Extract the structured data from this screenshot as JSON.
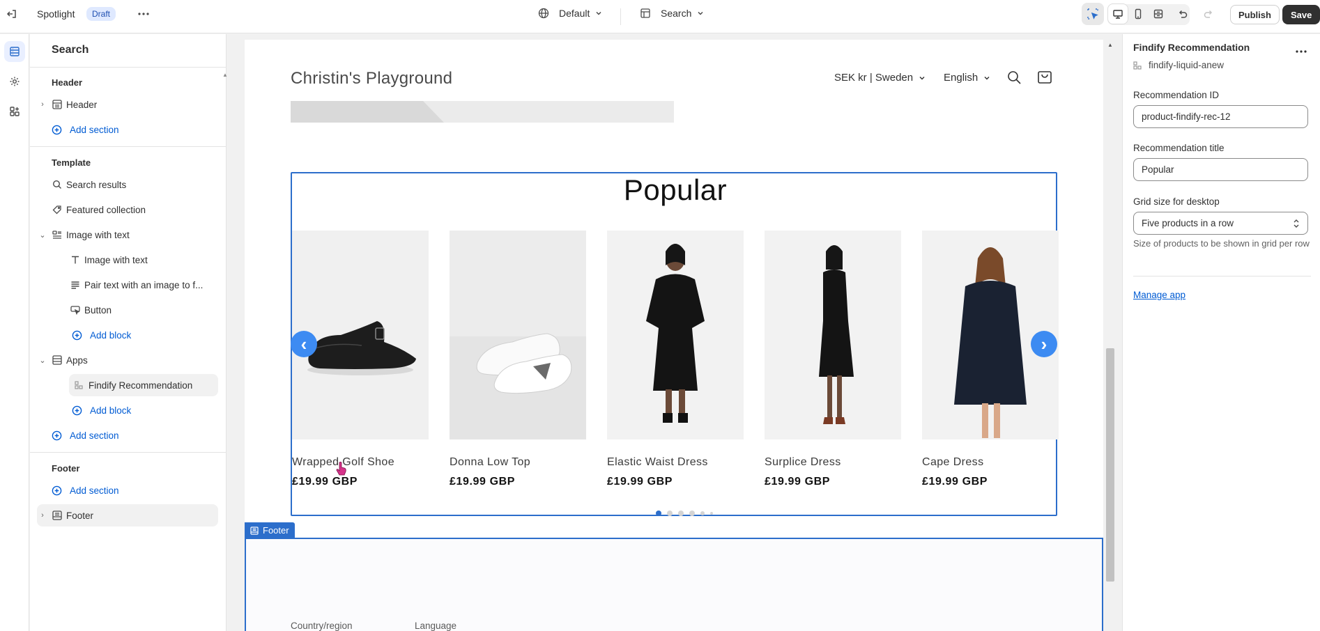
{
  "topbar": {
    "app_name": "Spotlight",
    "status_badge": "Draft",
    "theme_selector": "Default",
    "template_selector": "Search",
    "publish_label": "Publish",
    "save_label": "Save"
  },
  "sidebar": {
    "title": "Search",
    "header_group": "Header",
    "header_item": "Header",
    "add_section_1": "Add section",
    "template_group": "Template",
    "items": {
      "search_results": "Search results",
      "featured_collection": "Featured collection",
      "image_with_text": "Image with text",
      "image_with_text_block": "Image with text",
      "pair_text_block": "Pair text with an image to f...",
      "button_block": "Button",
      "add_block_1": "Add block",
      "apps": "Apps",
      "findify_recommendation": "Findify Recommendation",
      "add_block_2": "Add block",
      "add_section_2": "Add section"
    },
    "footer_group": "Footer",
    "add_section_3": "Add section",
    "footer_item": "Footer"
  },
  "preview": {
    "store_name": "Christin's Playground",
    "currency": "SEK kr | Sweden",
    "language": "English",
    "recommendation_title": "Popular",
    "products": [
      {
        "name": "Wrapped Golf Shoe",
        "price": "£19.99 GBP"
      },
      {
        "name": "Donna Low Top",
        "price": "£19.99 GBP"
      },
      {
        "name": "Elastic Waist Dress",
        "price": "£19.99 GBP"
      },
      {
        "name": "Surplice Dress",
        "price": "£19.99 GBP"
      },
      {
        "name": "Cape Dress",
        "price": "£19.99 GBP"
      }
    ],
    "carousel_page": 1,
    "carousel_pages": 6,
    "footer_tag": "Footer",
    "footer_country_label": "Country/region",
    "footer_language_label": "Language"
  },
  "settings": {
    "title": "Findify Recommendation",
    "subtitle": "findify-liquid-anew",
    "rec_id_label": "Recommendation ID",
    "rec_id_value": "product-findify-rec-12",
    "rec_title_label": "Recommendation title",
    "rec_title_value": "Popular",
    "grid_label": "Grid size for desktop",
    "grid_value": "Five products in a row",
    "grid_help": "Size of products to be shown in grid per row",
    "manage_link": "Manage app"
  },
  "colors": {
    "accent": "#2c6ecb",
    "link": "#005bd3",
    "save_button": "#303030",
    "arrow": "#3d8bf2"
  }
}
